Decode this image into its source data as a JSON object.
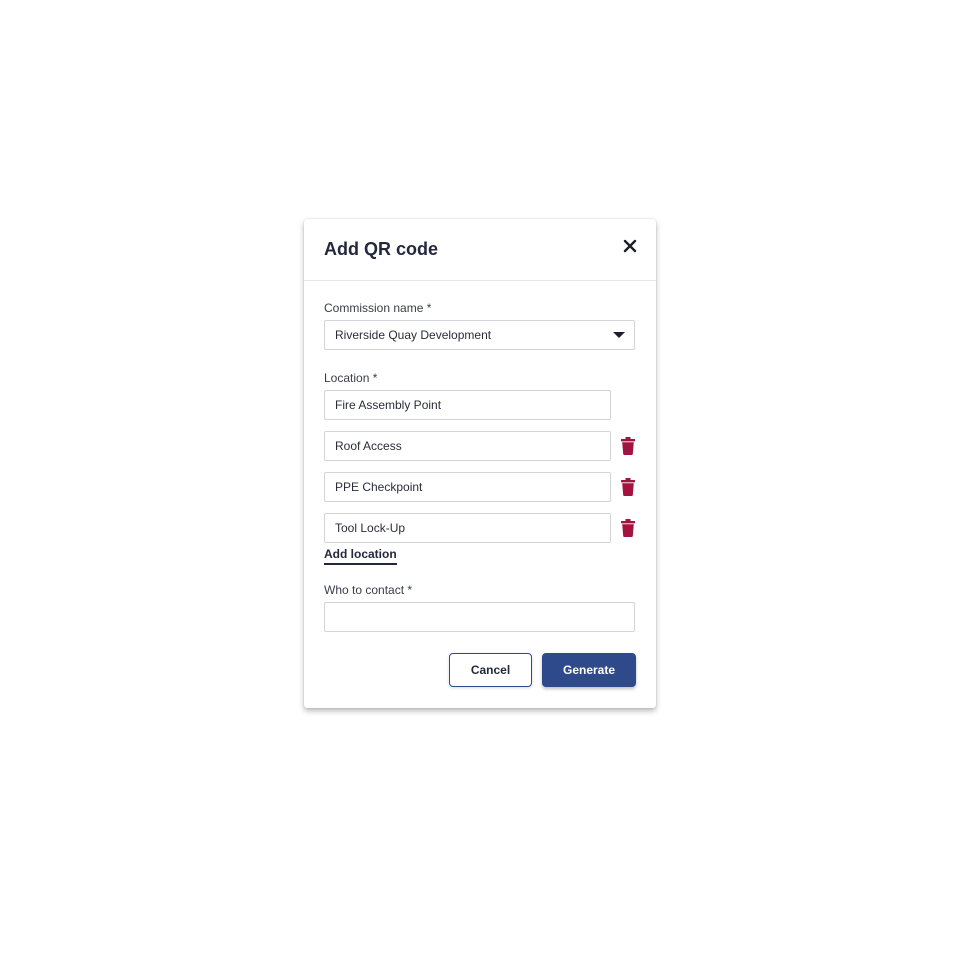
{
  "dialog": {
    "title": "Add QR code",
    "close_icon": "close-icon"
  },
  "commission": {
    "label": "Commission name *",
    "value": "Riverside Quay Development",
    "dropdown_icon": "caret-down-icon"
  },
  "location": {
    "label": "Location *",
    "items": [
      {
        "value": "Fire Assembly Point",
        "deletable": false
      },
      {
        "value": "Roof Access",
        "deletable": true
      },
      {
        "value": "PPE Checkpoint",
        "deletable": true
      },
      {
        "value": "Tool Lock-Up",
        "deletable": true
      }
    ],
    "delete_icon": "trash-icon",
    "add_label": "Add location"
  },
  "contact": {
    "label": "Who to contact *",
    "value": "",
    "placeholder": ""
  },
  "actions": {
    "cancel_label": "Cancel",
    "generate_label": "Generate"
  },
  "colors": {
    "primary": "#2f4a8a",
    "delete": "#a4123f",
    "title_text": "#23283d"
  }
}
